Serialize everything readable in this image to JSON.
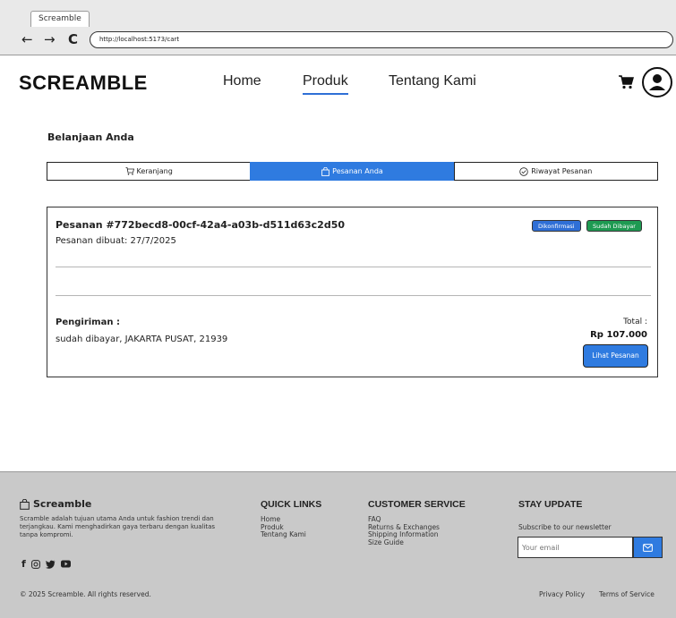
{
  "browser": {
    "tab_title": "Screamble",
    "back": "←",
    "forward": "→",
    "reload": "C",
    "url": "http://localhost:5173/cart"
  },
  "header": {
    "logo": "SCREAMBLE",
    "nav": [
      {
        "label": "Home"
      },
      {
        "label": "Produk"
      },
      {
        "label": "Tentang Kami"
      }
    ]
  },
  "page": {
    "title": "Belanjaan Anda",
    "tabs": [
      {
        "label": "Keranjang"
      },
      {
        "label": "Pesanan Anda"
      },
      {
        "label": "Riwayat Pesanan"
      }
    ]
  },
  "order": {
    "id": "Pesanan #772becd8-00cf-42a4-a03b-d511d63c2d50",
    "created": "Pesanan dibuat: 27/7/2025",
    "badge_status": "Dikonfirmasi",
    "badge_payment": "Sudah Dibayar",
    "shipping_label": "Pengiriman :",
    "shipping_value": "sudah dibayar, JAKARTA PUSAT, 21939",
    "total_label": "Total :",
    "total_value": "Rp 107.000",
    "view_button": "Lihat Pesanan"
  },
  "footer": {
    "brand": "Screamble",
    "description": "Scramble adalah tujuan utama Anda untuk fashion trendi dan terjangkau. Kami menghadirkan gaya terbaru dengan kualitas tanpa kompromi.",
    "quick_links": {
      "title": "QUICK LINKS",
      "items": [
        "Home",
        "Produk",
        "Tentang Kami"
      ]
    },
    "customer_service": {
      "title": "CUSTOMER SERVICE",
      "items": [
        "FAQ",
        "Returns & Exchanges",
        "Shipping Information",
        "Size Guide"
      ]
    },
    "stay_update": {
      "title": "STAY UPDATE",
      "subscribe_text": "Subscribe to our newsletter",
      "email_placeholder": "Your email"
    },
    "copyright": "© 2025 Screamble. All rights reserved.",
    "privacy": "Privacy Policy",
    "terms": "Terms of Service"
  },
  "colors": {
    "accent_blue": "#2f7be0",
    "paid_green": "#1e9a52",
    "footer_bg": "#c9c9c9"
  }
}
